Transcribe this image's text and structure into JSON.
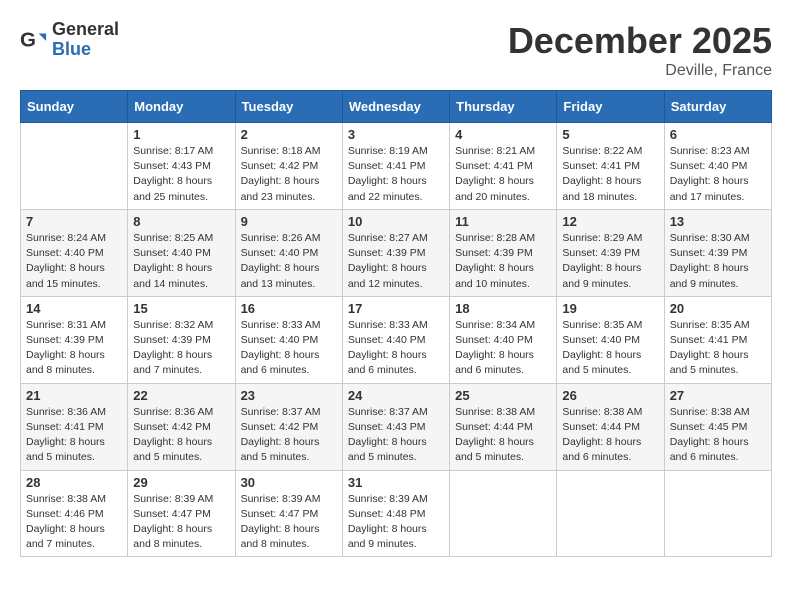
{
  "header": {
    "logo_general": "General",
    "logo_blue": "Blue",
    "month_title": "December 2025",
    "location": "Deville, France"
  },
  "weekdays": [
    "Sunday",
    "Monday",
    "Tuesday",
    "Wednesday",
    "Thursday",
    "Friday",
    "Saturday"
  ],
  "weeks": [
    [
      {
        "day": "",
        "info": ""
      },
      {
        "day": "1",
        "info": "Sunrise: 8:17 AM\nSunset: 4:43 PM\nDaylight: 8 hours\nand 25 minutes."
      },
      {
        "day": "2",
        "info": "Sunrise: 8:18 AM\nSunset: 4:42 PM\nDaylight: 8 hours\nand 23 minutes."
      },
      {
        "day": "3",
        "info": "Sunrise: 8:19 AM\nSunset: 4:41 PM\nDaylight: 8 hours\nand 22 minutes."
      },
      {
        "day": "4",
        "info": "Sunrise: 8:21 AM\nSunset: 4:41 PM\nDaylight: 8 hours\nand 20 minutes."
      },
      {
        "day": "5",
        "info": "Sunrise: 8:22 AM\nSunset: 4:41 PM\nDaylight: 8 hours\nand 18 minutes."
      },
      {
        "day": "6",
        "info": "Sunrise: 8:23 AM\nSunset: 4:40 PM\nDaylight: 8 hours\nand 17 minutes."
      }
    ],
    [
      {
        "day": "7",
        "info": "Sunrise: 8:24 AM\nSunset: 4:40 PM\nDaylight: 8 hours\nand 15 minutes."
      },
      {
        "day": "8",
        "info": "Sunrise: 8:25 AM\nSunset: 4:40 PM\nDaylight: 8 hours\nand 14 minutes."
      },
      {
        "day": "9",
        "info": "Sunrise: 8:26 AM\nSunset: 4:40 PM\nDaylight: 8 hours\nand 13 minutes."
      },
      {
        "day": "10",
        "info": "Sunrise: 8:27 AM\nSunset: 4:39 PM\nDaylight: 8 hours\nand 12 minutes."
      },
      {
        "day": "11",
        "info": "Sunrise: 8:28 AM\nSunset: 4:39 PM\nDaylight: 8 hours\nand 10 minutes."
      },
      {
        "day": "12",
        "info": "Sunrise: 8:29 AM\nSunset: 4:39 PM\nDaylight: 8 hours\nand 9 minutes."
      },
      {
        "day": "13",
        "info": "Sunrise: 8:30 AM\nSunset: 4:39 PM\nDaylight: 8 hours\nand 9 minutes."
      }
    ],
    [
      {
        "day": "14",
        "info": "Sunrise: 8:31 AM\nSunset: 4:39 PM\nDaylight: 8 hours\nand 8 minutes."
      },
      {
        "day": "15",
        "info": "Sunrise: 8:32 AM\nSunset: 4:39 PM\nDaylight: 8 hours\nand 7 minutes."
      },
      {
        "day": "16",
        "info": "Sunrise: 8:33 AM\nSunset: 4:40 PM\nDaylight: 8 hours\nand 6 minutes."
      },
      {
        "day": "17",
        "info": "Sunrise: 8:33 AM\nSunset: 4:40 PM\nDaylight: 8 hours\nand 6 minutes."
      },
      {
        "day": "18",
        "info": "Sunrise: 8:34 AM\nSunset: 4:40 PM\nDaylight: 8 hours\nand 6 minutes."
      },
      {
        "day": "19",
        "info": "Sunrise: 8:35 AM\nSunset: 4:40 PM\nDaylight: 8 hours\nand 5 minutes."
      },
      {
        "day": "20",
        "info": "Sunrise: 8:35 AM\nSunset: 4:41 PM\nDaylight: 8 hours\nand 5 minutes."
      }
    ],
    [
      {
        "day": "21",
        "info": "Sunrise: 8:36 AM\nSunset: 4:41 PM\nDaylight: 8 hours\nand 5 minutes."
      },
      {
        "day": "22",
        "info": "Sunrise: 8:36 AM\nSunset: 4:42 PM\nDaylight: 8 hours\nand 5 minutes."
      },
      {
        "day": "23",
        "info": "Sunrise: 8:37 AM\nSunset: 4:42 PM\nDaylight: 8 hours\nand 5 minutes."
      },
      {
        "day": "24",
        "info": "Sunrise: 8:37 AM\nSunset: 4:43 PM\nDaylight: 8 hours\nand 5 minutes."
      },
      {
        "day": "25",
        "info": "Sunrise: 8:38 AM\nSunset: 4:44 PM\nDaylight: 8 hours\nand 5 minutes."
      },
      {
        "day": "26",
        "info": "Sunrise: 8:38 AM\nSunset: 4:44 PM\nDaylight: 8 hours\nand 6 minutes."
      },
      {
        "day": "27",
        "info": "Sunrise: 8:38 AM\nSunset: 4:45 PM\nDaylight: 8 hours\nand 6 minutes."
      }
    ],
    [
      {
        "day": "28",
        "info": "Sunrise: 8:38 AM\nSunset: 4:46 PM\nDaylight: 8 hours\nand 7 minutes."
      },
      {
        "day": "29",
        "info": "Sunrise: 8:39 AM\nSunset: 4:47 PM\nDaylight: 8 hours\nand 8 minutes."
      },
      {
        "day": "30",
        "info": "Sunrise: 8:39 AM\nSunset: 4:47 PM\nDaylight: 8 hours\nand 8 minutes."
      },
      {
        "day": "31",
        "info": "Sunrise: 8:39 AM\nSunset: 4:48 PM\nDaylight: 8 hours\nand 9 minutes."
      },
      {
        "day": "",
        "info": ""
      },
      {
        "day": "",
        "info": ""
      },
      {
        "day": "",
        "info": ""
      }
    ]
  ]
}
